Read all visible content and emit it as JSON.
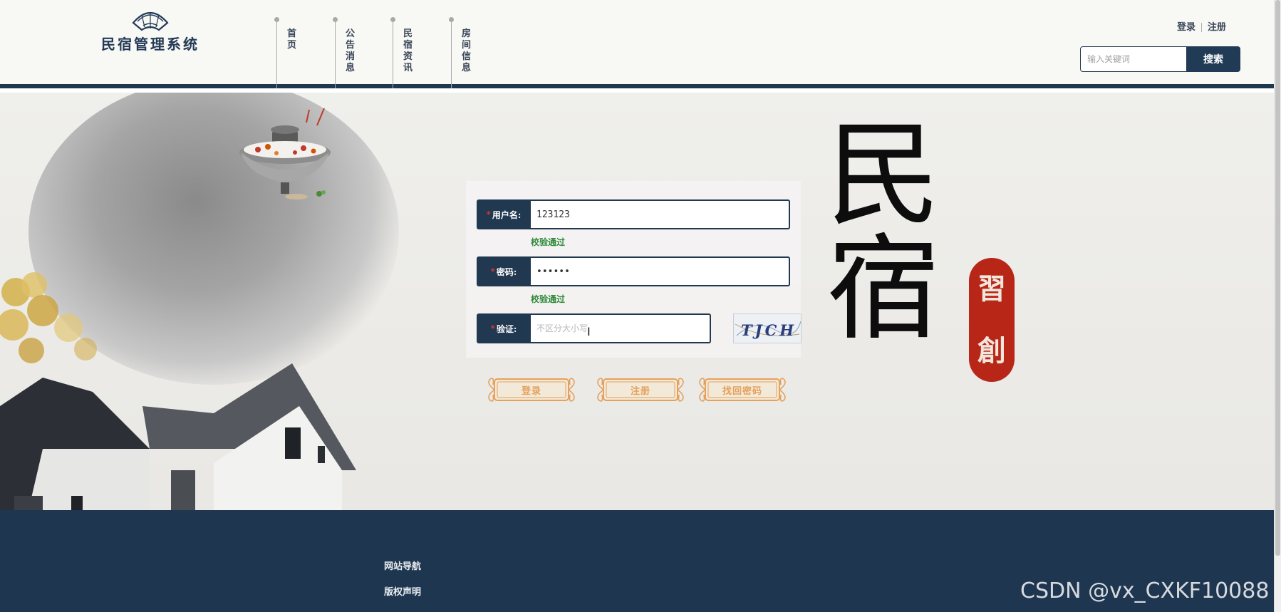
{
  "header": {
    "site_title": "民宿管理系统",
    "logo_icon": "fan-icon",
    "nav_items": [
      {
        "label": "首页"
      },
      {
        "label": "公告消息"
      },
      {
        "label": "民宿资讯"
      },
      {
        "label": "房间信息"
      }
    ],
    "login_link": "登录",
    "register_link": "注册",
    "search": {
      "placeholder": "输入关键词",
      "value": "",
      "button_label": "搜索"
    }
  },
  "hero": {
    "big_chars": [
      "民",
      "宿"
    ],
    "seal_chars": [
      "習",
      "創"
    ]
  },
  "login_form": {
    "username": {
      "label": "用户名:",
      "value": "123123",
      "hint": "校验通过"
    },
    "password": {
      "label": "密码:",
      "value": "••••••",
      "hint": "校验通过"
    },
    "captcha": {
      "label": "验证:",
      "placeholder": "不区分大小写",
      "value": "",
      "image_text": "TJCH"
    },
    "buttons": {
      "login": "登录",
      "register": "注册",
      "recover": "找回密码"
    },
    "required_mark": "*"
  },
  "footer": {
    "links": [
      "网站导航",
      "版权声明"
    ]
  },
  "watermark": "CSDN @vx_CXKF10088",
  "colors": {
    "primary": "#1f3850",
    "accent": "#e6a05a",
    "success": "#2f8a3a",
    "seal": "#b72617",
    "required": "#e3352a"
  }
}
